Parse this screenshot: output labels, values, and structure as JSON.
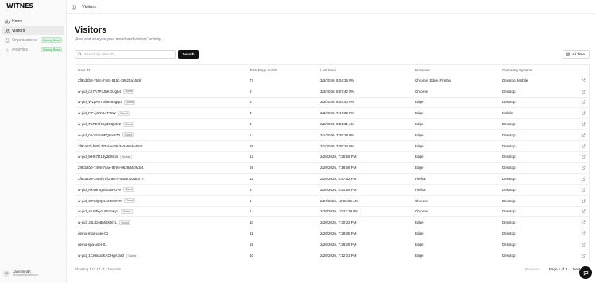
{
  "brand": "WITNES",
  "sidebar": {
    "items": [
      {
        "label": "Home",
        "icon": "home-icon"
      },
      {
        "label": "Visitors",
        "icon": "users-icon",
        "active": true
      },
      {
        "label": "Organizations",
        "icon": "building-icon",
        "badge": "Coming Soon"
      },
      {
        "label": "Analytics",
        "icon": "bar-chart-icon",
        "badge": "Coming Soon"
      }
    ],
    "user": {
      "initials": "JS",
      "name": "Jane Smith",
      "email": "employee@witnes.io"
    }
  },
  "topbar": {
    "title": "Visitors"
  },
  "page": {
    "title": "Visitors",
    "subtitle": "View and analyze your monitored visitors' activity.",
    "search_placeholder": "Search by User ID...",
    "search_label": "Search",
    "time_filter": "All Time"
  },
  "table": {
    "columns": [
      "User ID",
      "Total Page Loads",
      "Last Seen",
      "Browsers",
      "Operating Systems"
    ],
    "guest_label": "Guest",
    "rows": [
      {
        "id": "2f9cd2b0-758c-7481-915c-39625a1659f",
        "guest": false,
        "loads": "77",
        "seen": "3/3/2026, 8:24:36 PM",
        "browsers": "Chrome, Edge, Firefox",
        "os": "Desktop, Mobile"
      },
      {
        "id": "w-gid_cX7A7P3JhKGUgb4",
        "guest": true,
        "loads": "2",
        "seen": "3/3/2026, 8:07:42 PM",
        "browsers": "Chrome",
        "os": "Desktop"
      },
      {
        "id": "w-gid_WLpAoTfxh6493gqU",
        "guest": true,
        "loads": "3",
        "seen": "3/3/2026, 8:04:40 PM",
        "browsers": "Edge",
        "os": "Desktop"
      },
      {
        "id": "w-gid_FIF4jX4YLvPf5W",
        "guest": true,
        "loads": "3",
        "seen": "3/3/2026, 7:47:32 PM",
        "browsers": "Edge",
        "os": "Mobile"
      },
      {
        "id": "w-gid_T5PDsf4bgdQQxbr2",
        "guest": true,
        "loads": "3",
        "seen": "3/2/2026, 9:51:31 AM",
        "browsers": "Edge",
        "os": "Desktop"
      },
      {
        "id": "w-gid_0noFl4nDFQ8rv4Z0",
        "guest": true,
        "loads": "1",
        "seen": "3/1/2026, 7:29:28 PM",
        "browsers": "Edge",
        "os": "Desktop"
      },
      {
        "id": "2f9ca57f-b80f-7754-ac36-3a3a594e43c8",
        "guest": false,
        "loads": "28",
        "seen": "3/1/2026, 7:29:24 PM",
        "browsers": "Edge",
        "os": "Desktop"
      },
      {
        "id": "w-gid_IkH57D13ydb9sbn",
        "guest": true,
        "loads": "12",
        "seen": "2/28/2026, 7:25:59 PM",
        "browsers": "Edge",
        "os": "Desktop"
      },
      {
        "id": "2f9cb2b0-7495-7cae-87ee-0628d4cf9dc4",
        "guest": false,
        "loads": "69",
        "seen": "2/28/2026, 7:19:56 PM",
        "browsers": "Edge",
        "os": "Desktop"
      },
      {
        "id": "2f9ca523-348d-76f1-a07c-44d8722a6377",
        "guest": false,
        "loads": "12",
        "seen": "2/28/2026, 5:57:52 PM",
        "browsers": "Firefox",
        "os": "Desktop"
      },
      {
        "id": "w-gid_HkV9nrg04x3bPGvv",
        "guest": true,
        "loads": "6",
        "seen": "2/28/2026, 5:51:59 PM",
        "browsers": "Firefox",
        "os": "Desktop"
      },
      {
        "id": "w-gid_CFGQiQyLnKEWNR",
        "guest": true,
        "loads": "1",
        "seen": "2/27/2026, 12:02:26 AM",
        "browsers": "Chrome",
        "os": "Desktop"
      },
      {
        "id": "w-gid_4KnPky1u55znKy3",
        "guest": true,
        "loads": "1",
        "seen": "2/26/2026, 10:22:19 PM",
        "browsers": "Chrome",
        "os": "Desktop"
      },
      {
        "id": "w-gid_J8Ldzo8Mj6K9j7L",
        "guest": true,
        "loads": "10",
        "seen": "2/26/2026, 7:30:02 PM",
        "browsers": "Edge",
        "os": "Desktop"
      },
      {
        "id": "demo-mpa-user-01",
        "guest": false,
        "loads": "11",
        "seen": "2/26/2026, 7:29:35 PM",
        "browsers": "Edge",
        "os": "Desktop"
      },
      {
        "id": "demo-spa-user-01",
        "guest": false,
        "loads": "18",
        "seen": "2/26/2026, 7:29:28 PM",
        "browsers": "Edge",
        "os": "Desktop"
      },
      {
        "id": "w-gid_1Ce8uodKAOHgADa0",
        "guest": true,
        "loads": "10",
        "seen": "2/26/2026, 7:12:01 PM",
        "browsers": "Edge",
        "os": "Desktop"
      }
    ]
  },
  "footer": {
    "showing": "Showing 1 to 17 of 17 results",
    "prev": "Previous",
    "page": "Page 1 of 1",
    "next": "Next"
  }
}
